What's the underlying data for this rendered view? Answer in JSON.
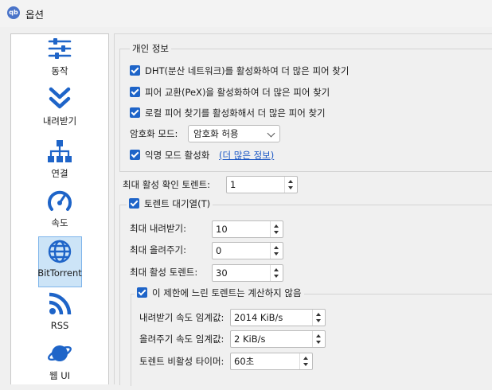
{
  "window": {
    "title": "옵션",
    "app_icon_text": "qb"
  },
  "sidebar": {
    "items": [
      {
        "label": "동작",
        "icon": "sliders-icon"
      },
      {
        "label": "내려받기",
        "icon": "double-chevron-down-icon"
      },
      {
        "label": "연결",
        "icon": "network-icon"
      },
      {
        "label": "속도",
        "icon": "speedometer-icon"
      },
      {
        "label": "BitTorrent",
        "icon": "globe-icon",
        "selected": true
      },
      {
        "label": "RSS",
        "icon": "rss-icon"
      },
      {
        "label": "웹 UI",
        "icon": "planet-icon"
      }
    ]
  },
  "privacy": {
    "title": "개인 정보",
    "dht": "DHT(분산 네트워크)를 활성화하여 더 많은 피어 찾기",
    "pex": "피어 교환(PeX)을 활성화하여 더 많은 피어 찾기",
    "lsd": "로컬 피어 찾기를 활성화해서 더 많은 피어 찾기",
    "encryption_label": "암호화 모드:",
    "encryption_value": "암호화 허용",
    "anon_label": "익명 모드 활성화",
    "anon_link_open": "(",
    "anon_link": "더 많은 정보",
    "anon_link_close": ")"
  },
  "max_checking": {
    "label": "최대 활성 확인 토렌트:",
    "value": "1"
  },
  "queue": {
    "title": "토렌트 대기열(T)",
    "max_downloads": {
      "label": "최대 내려받기:",
      "value": "10"
    },
    "max_uploads": {
      "label": "최대 올려주기:",
      "value": "0"
    },
    "max_active": {
      "label": "최대 활성 토렌트:",
      "value": "30"
    },
    "slow": {
      "title": "이 제한에 느린 토렌트는 계산하지 않음",
      "dl_threshold": {
        "label": "내려받기 속도 임계값:",
        "value": "2014 KiB/s"
      },
      "ul_threshold": {
        "label": "올려주기 속도 임계값:",
        "value": "2 KiB/s"
      },
      "inactivity": {
        "label": "토렌트 비활성 타이머:",
        "value": "60초"
      }
    }
  },
  "colors": {
    "accent": "#1e64c8",
    "selection": "#cce4f7",
    "link": "#1a56c4"
  }
}
